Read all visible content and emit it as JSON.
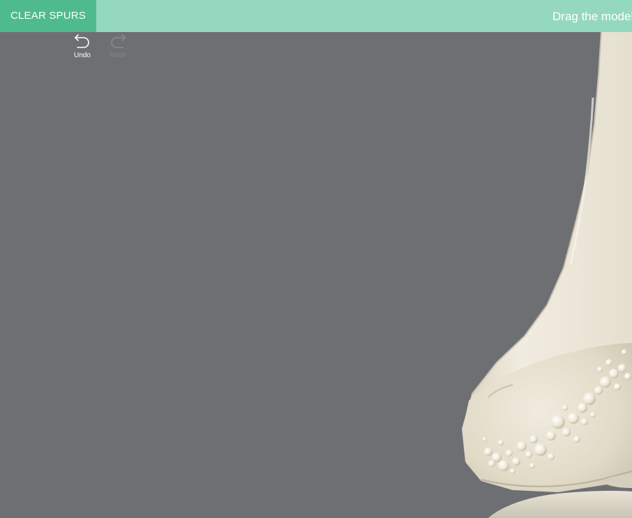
{
  "toolbar": {
    "clear_label": "CLEAR SPURS",
    "hint": "Drag the model"
  },
  "history": {
    "undo_label": "Undo",
    "redo_label": "Redo"
  },
  "icons": {
    "undo": "undo-arrow-icon",
    "redo": "redo-arrow-icon"
  },
  "colors": {
    "toolbar_bg": "#95d8c0",
    "button_bg": "#4fba8d",
    "canvas_bg": "#6e6f73",
    "bone": "#ece6d6"
  }
}
